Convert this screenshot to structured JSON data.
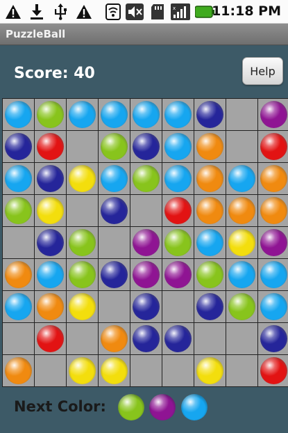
{
  "status_bar": {
    "icons": [
      "warning-icon",
      "download-icon",
      "usb-icon",
      "warning-icon",
      "wifi-icon",
      "mute-icon",
      "sd-card-icon",
      "signal-icon",
      "battery-icon"
    ],
    "time": "11:18 PM"
  },
  "app": {
    "title": "PuzzleBall"
  },
  "header": {
    "score_text": "Score: 40",
    "help_label": "Help"
  },
  "colors": {
    "cyan": "#16a6f0",
    "green": "#88c41c",
    "navy": "#25259a",
    "purple": "#8f1493",
    "red": "#e21313",
    "orange": "#f08a10",
    "yellow": "#f3de0d",
    "cell": "#a4a4a4",
    "background": "#3d5a67"
  },
  "board": {
    "rows": [
      [
        "cyan",
        "green",
        "cyan",
        "cyan",
        "cyan",
        "cyan",
        "navy",
        null,
        "purple"
      ],
      [
        "navy",
        "red",
        null,
        "green",
        "navy",
        "cyan",
        "orange",
        null,
        "red"
      ],
      [
        "cyan",
        "navy",
        "yellow",
        "cyan",
        "green",
        "cyan",
        "orange",
        "cyan",
        "orange"
      ],
      [
        "green",
        "yellow",
        null,
        "navy",
        null,
        "red",
        "orange",
        "orange",
        "orange"
      ],
      [
        null,
        "navy",
        "green",
        null,
        "purple",
        "green",
        "cyan",
        "yellow",
        "purple"
      ],
      [
        "orange",
        "cyan",
        "green",
        "navy",
        "purple",
        "purple",
        "green",
        "cyan",
        "cyan"
      ],
      [
        "cyan",
        "orange",
        "yellow",
        null,
        "navy",
        null,
        "navy",
        "green",
        "cyan"
      ],
      [
        null,
        "red",
        null,
        "orange",
        "navy",
        "navy",
        null,
        null,
        "navy"
      ],
      [
        "orange",
        null,
        "yellow",
        "yellow",
        null,
        null,
        "yellow",
        null,
        "red"
      ]
    ]
  },
  "next": {
    "label": "Next Color:",
    "balls": [
      "green",
      "purple",
      "cyan"
    ]
  }
}
